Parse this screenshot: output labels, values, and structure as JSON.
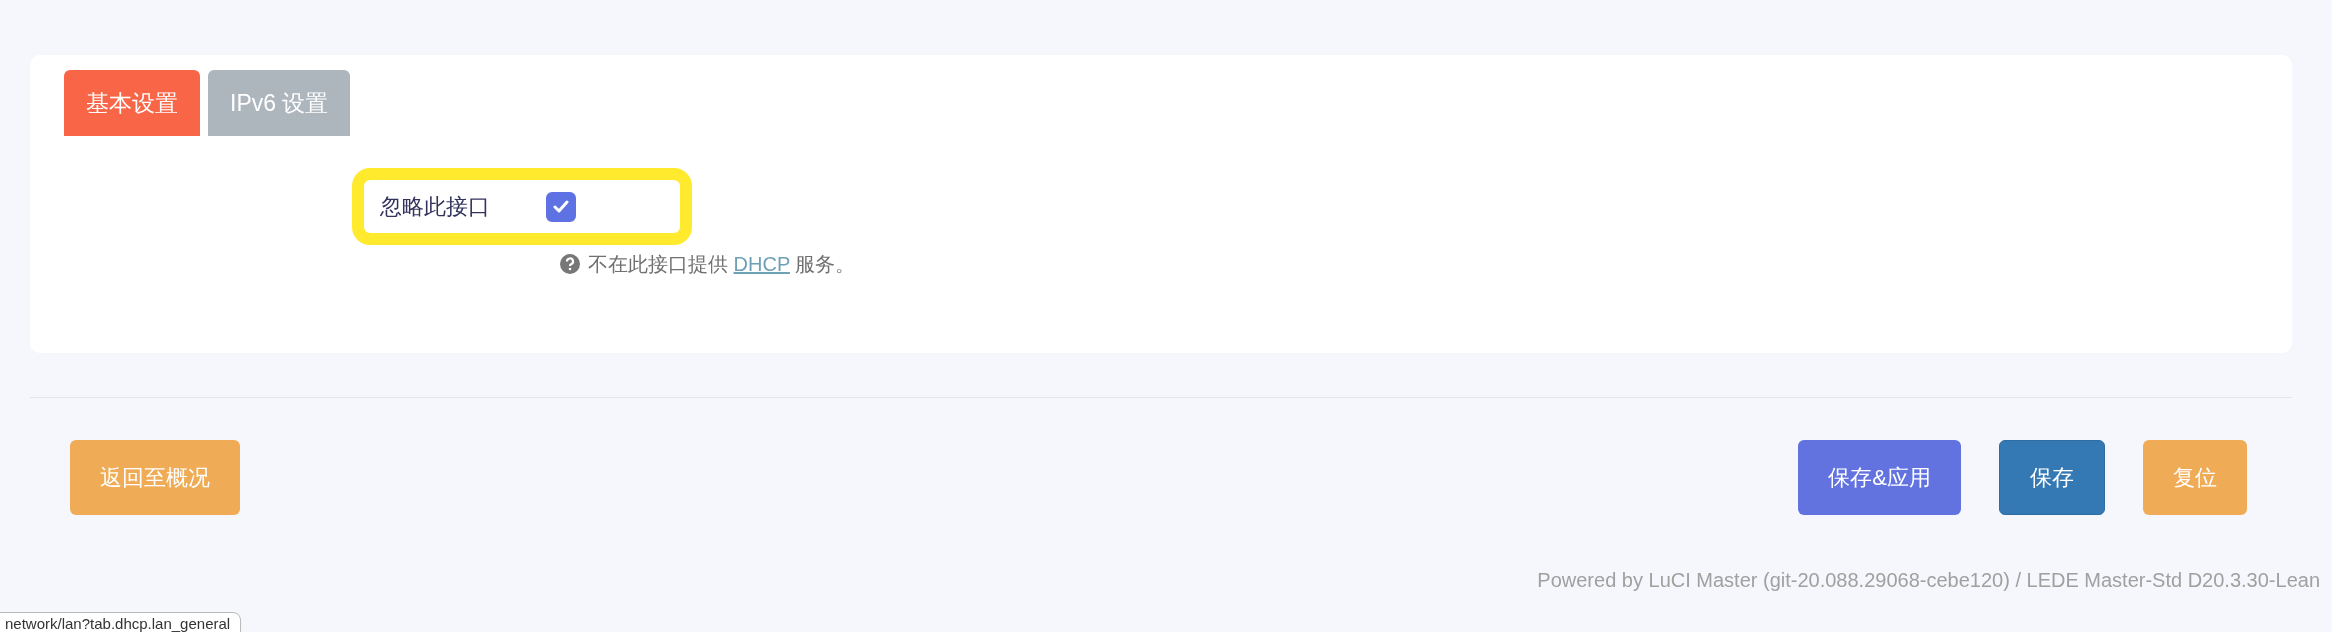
{
  "tabs": [
    {
      "label": "基本设置",
      "selected": true
    },
    {
      "label": "IPv6 设置",
      "selected": false
    }
  ],
  "fields": [
    {
      "kind": "checkbox",
      "label": "忽略此接口",
      "checked": true,
      "highlighted": true,
      "hint": {
        "before": "不在此接口提供",
        "link": "DHCP",
        "after": "服务。"
      }
    }
  ],
  "actions_left": [
    {
      "label": "返回至概况",
      "kind": "back"
    }
  ],
  "actions_right": [
    {
      "label": "保存&应用",
      "kind": "apply"
    },
    {
      "label": "保存",
      "kind": "save"
    },
    {
      "label": "复位",
      "kind": "reset"
    }
  ],
  "footer": "Powered by LuCI Master (git-20.088.29068-cebe120) / LEDE Master-Std D20.3.30-Lean",
  "status_url": "network/lan?tab.dhcp.lan_general"
}
